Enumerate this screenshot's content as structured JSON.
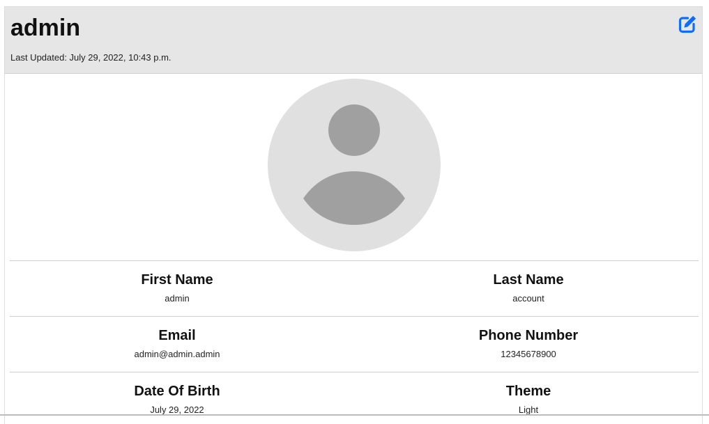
{
  "header": {
    "username": "admin",
    "last_updated": "Last Updated: July 29, 2022, 10:43 p.m.",
    "edit_icon": "edit-square-pen-icon"
  },
  "avatar": {
    "icon": "default-user-avatar-icon"
  },
  "fields": {
    "first_name": {
      "label": "First Name",
      "value": "admin"
    },
    "last_name": {
      "label": "Last Name",
      "value": "account"
    },
    "email": {
      "label": "Email",
      "value": "admin@admin.admin"
    },
    "phone": {
      "label": "Phone Number",
      "value": "12345678900"
    },
    "dob": {
      "label": "Date Of Birth",
      "value": "July 29, 2022"
    },
    "theme": {
      "label": "Theme",
      "value": "Light"
    }
  },
  "colors": {
    "header_bg": "#e6e6e6",
    "accent": "#0d6efd",
    "avatar_bg": "#e0e0e0",
    "avatar_fg": "#a0a0a0"
  }
}
